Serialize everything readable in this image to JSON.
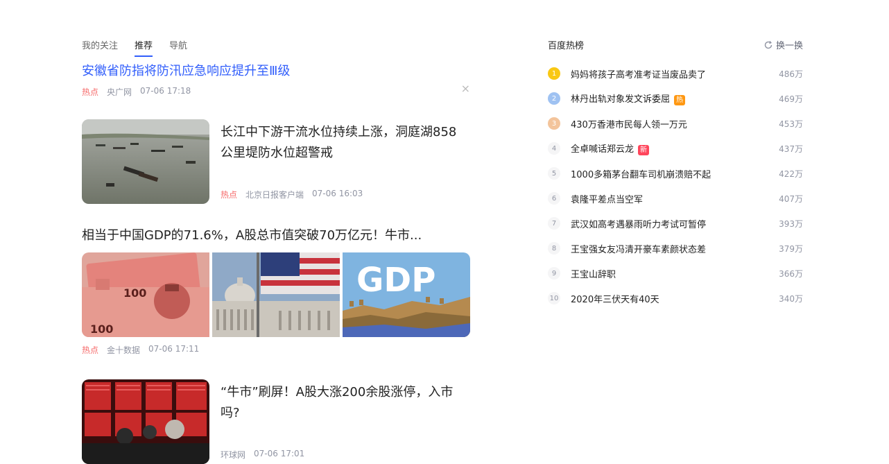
{
  "tabs": [
    "我的关注",
    "推荐",
    "导航"
  ],
  "top_news": {
    "title": "安徽省防指将防汛应急响应提升至Ⅲ级",
    "hot": "热点",
    "source": "央广网",
    "time": "07-06 17:18",
    "close": "×"
  },
  "card1": {
    "title": "长江中下游干流水位持续上涨，洞庭湖858公里堤防水位超警戒",
    "hot": "热点",
    "source": "北京日报客户端",
    "time": "07-06 16:03"
  },
  "card2": {
    "title": "相当于中国GDP的71.6%，A股总市值突破70万亿元！牛市...",
    "gdp_text": "GDP",
    "banknote_text": "100",
    "hot": "热点",
    "source": "金十数据",
    "time": "07-06 17:11"
  },
  "card3": {
    "title": "“牛市”刷屏！A股大涨200余股涨停，入市吗?",
    "source": "环球网",
    "time": "07-06 17:01"
  },
  "hotlist": {
    "title": "百度热榜",
    "refresh": "换一换",
    "items": [
      {
        "rank": "1",
        "text": "妈妈将孩子高考准考证当废品卖了",
        "count": "486万",
        "tag": ""
      },
      {
        "rank": "2",
        "text": "林丹出轨对象发文诉委屈",
        "count": "469万",
        "tag": "热"
      },
      {
        "rank": "3",
        "text": "430万香港市民每人领一万元",
        "count": "453万",
        "tag": ""
      },
      {
        "rank": "4",
        "text": "全卓喊话郑云龙",
        "count": "437万",
        "tag": "新"
      },
      {
        "rank": "5",
        "text": "1000多箱茅台翻车司机崩溃赔不起",
        "count": "422万",
        "tag": ""
      },
      {
        "rank": "6",
        "text": "袁隆平差点当空军",
        "count": "407万",
        "tag": ""
      },
      {
        "rank": "7",
        "text": "武汉如高考遇暴雨听力考试可暂停",
        "count": "393万",
        "tag": ""
      },
      {
        "rank": "8",
        "text": "王宝强女友冯清开豪车素颜状态差",
        "count": "379万",
        "tag": ""
      },
      {
        "rank": "9",
        "text": "王宝山辞职",
        "count": "366万",
        "tag": ""
      },
      {
        "rank": "10",
        "text": "2020年三伏天有40天",
        "count": "340万",
        "tag": ""
      }
    ]
  }
}
